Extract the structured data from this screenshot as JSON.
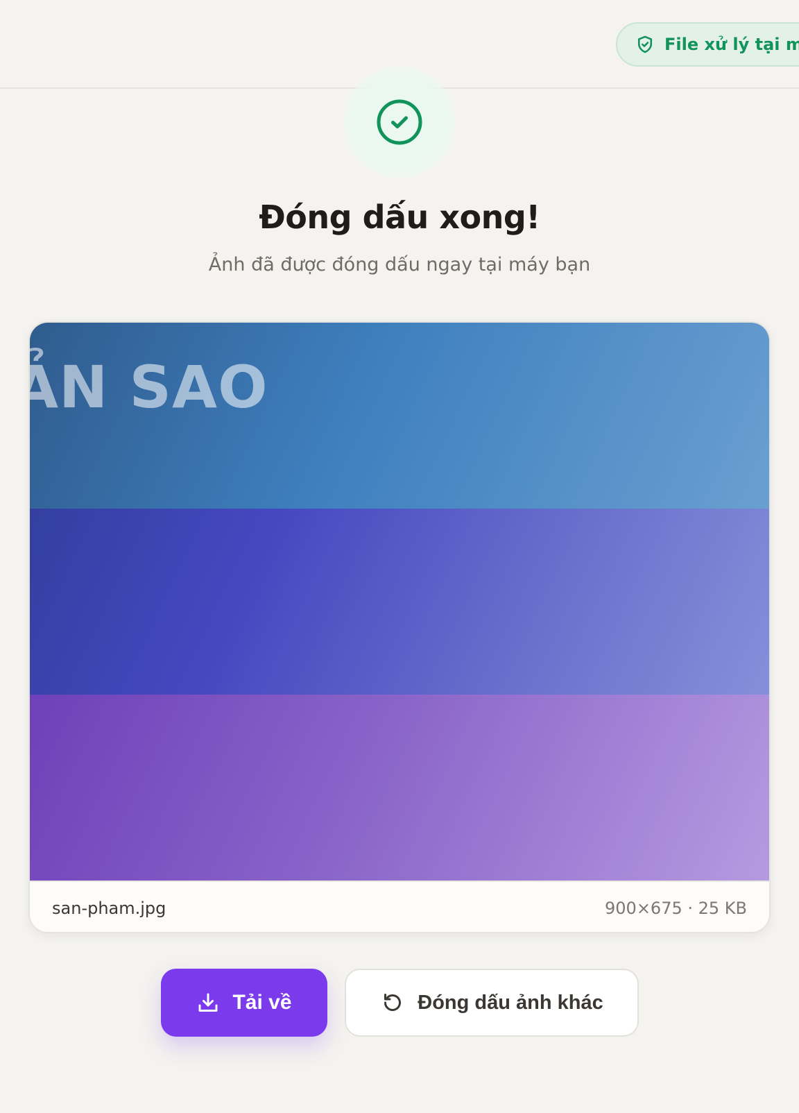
{
  "header": {
    "privacy_badge": "File xử lý tại máy"
  },
  "result": {
    "title": "Đóng dấu xong!",
    "subtitle": "Ảnh đã được đóng dấu ngay tại máy bạn"
  },
  "preview": {
    "watermark_text": "ẢN SAO",
    "file_name": "san-pham.jpg",
    "file_info": "900×675 · 25 KB"
  },
  "actions": {
    "download_label": "Tải về",
    "again_label": "Đóng dấu ảnh khác"
  },
  "colors": {
    "accent": "#7c3aed",
    "success": "#13935c",
    "background": "#f4f3ef"
  },
  "icons": {
    "badge": "shield-check-icon",
    "status": "check-circle-icon",
    "download": "download-icon",
    "again": "rotate-ccw-icon"
  }
}
